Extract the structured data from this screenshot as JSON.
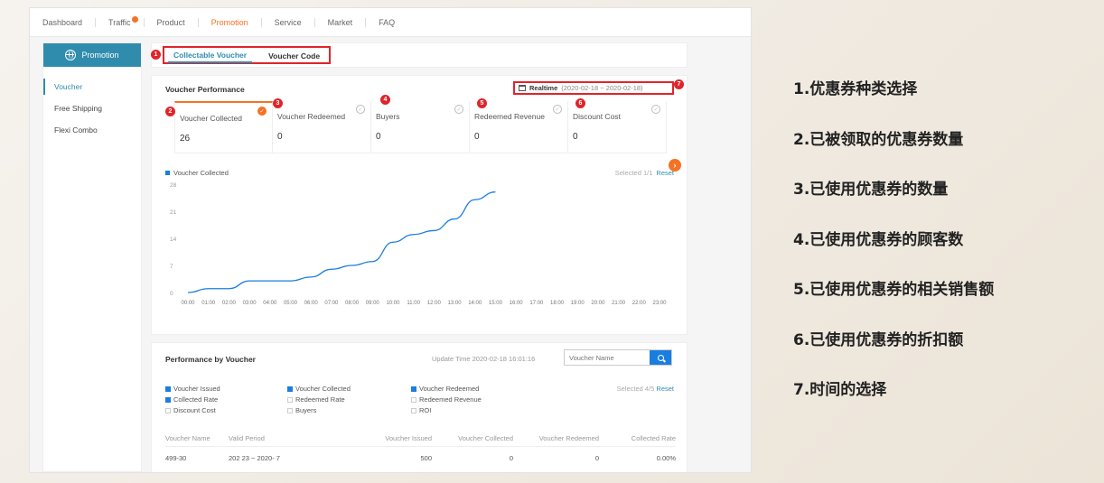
{
  "topnav": {
    "items": [
      "Dashboard",
      "Traffic",
      "Product",
      "Promotion",
      "Service",
      "Market",
      "FAQ"
    ]
  },
  "sidebar": {
    "header": "Promotion",
    "items": [
      "Voucher",
      "Free Shipping",
      "Flexi Combo"
    ]
  },
  "tabs": [
    "Collectable Voucher",
    "Voucher Code"
  ],
  "performance": {
    "title": "Voucher Performance",
    "realtime_label": "Realtime",
    "date_range": "(2020-02-18 ~ 2020-02-18)",
    "metrics": [
      {
        "label": "Voucher Collected",
        "value": "26"
      },
      {
        "label": "Voucher Redeemed",
        "value": "0"
      },
      {
        "label": "Buyers",
        "value": "0"
      },
      {
        "label": "Redeemed Revenue",
        "value": "0"
      },
      {
        "label": "Discount Cost",
        "value": "0"
      }
    ],
    "legend": "Voucher Collected",
    "selected": "Selected 1/1",
    "reset": "Reset"
  },
  "chart_data": {
    "type": "line",
    "x": [
      "00:00",
      "01:00",
      "02:00",
      "03:00",
      "04:00",
      "05:00",
      "06:00",
      "07:00",
      "08:00",
      "09:00",
      "10:00",
      "11:00",
      "12:00",
      "13:00",
      "14:00",
      "15:00",
      "16:00",
      "17:00",
      "18:00",
      "19:00",
      "20:00",
      "21:00",
      "22:00",
      "23:00"
    ],
    "series": [
      {
        "name": "Voucher Collected",
        "values": [
          0,
          1,
          1,
          3,
          3,
          3,
          4,
          6,
          7,
          8,
          13,
          15,
          16,
          19,
          24,
          26
        ]
      }
    ],
    "ylim": [
      0,
      28
    ],
    "yticks": [
      0,
      7,
      14,
      21,
      28
    ],
    "color": "#1a7ee0"
  },
  "by_voucher": {
    "title": "Performance by Voucher",
    "update_time": "Update Time 2020-02-18 16:01:16",
    "search_placeholder": "Voucher Name",
    "options": [
      {
        "label": "Voucher Issued",
        "checked": true
      },
      {
        "label": "Voucher Collected",
        "checked": true
      },
      {
        "label": "Voucher Redeemed",
        "checked": true
      },
      {
        "label": "Collected Rate",
        "checked": true
      },
      {
        "label": "Redeemed Rate",
        "checked": false
      },
      {
        "label": "Redeemed Revenue",
        "checked": false
      },
      {
        "label": "Discount Cost",
        "checked": false
      },
      {
        "label": "Buyers",
        "checked": false
      },
      {
        "label": "ROI",
        "checked": false
      }
    ],
    "selected": "Selected 4/5",
    "reset": "Reset",
    "columns": [
      "Voucher Name",
      "Valid Period",
      "Voucher Issued",
      "Voucher Collected",
      "Voucher Redeemed",
      "Collected Rate"
    ],
    "rows": [
      [
        "499-30",
        "202  23 ~ 2020-  7",
        "500",
        "0",
        "0",
        "0.00%"
      ]
    ]
  },
  "annotations": [
    "1.优惠券种类选择",
    "2.已被领取的优惠券数量",
    "3.已使用优惠券的数量",
    "4.已使用优惠券的顾客数",
    "5.已使用优惠券的相关销售额",
    "6.已使用优惠券的折扣额",
    "7.时间的选择"
  ],
  "badges": [
    "1",
    "2",
    "3",
    "4",
    "5",
    "6",
    "7"
  ]
}
